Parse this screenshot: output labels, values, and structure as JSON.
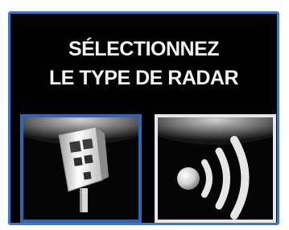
{
  "screen": {
    "title_line1": "SÉLECTIONNEZ",
    "title_line2": "LE TYPE DE RADAR"
  },
  "options": [
    {
      "icon": "fixed-radar-icon",
      "state": "unselected",
      "border_color": "#2e65b4"
    },
    {
      "icon": "mobile-radar-icon",
      "state": "highlighted",
      "border_color": "#e6e6e6"
    }
  ],
  "colors": {
    "frame": "#3a78c8",
    "background": "#000000",
    "text": "#f2f2f2"
  }
}
